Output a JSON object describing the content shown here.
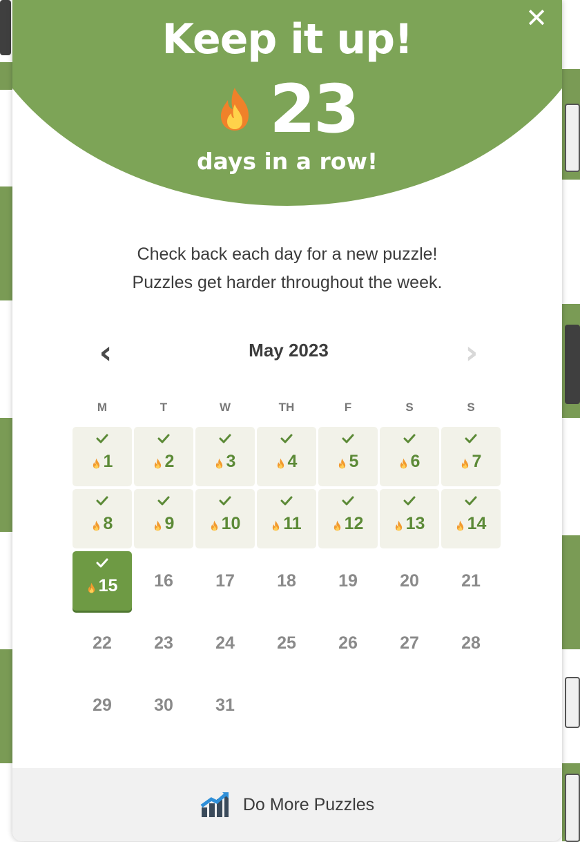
{
  "modal": {
    "title": "Keep it up!",
    "streak_count": "23",
    "streak_label": "days in a row!",
    "close_icon": "close-icon",
    "info_line1": "Check back each day for a new puzzle!",
    "info_line2": "Puzzles get harder throughout the week."
  },
  "calendar": {
    "month_label": "May 2023",
    "prev_icon": "chevron-left-icon",
    "next_icon": "chevron-right-icon",
    "weekdays": [
      "M",
      "T",
      "W",
      "TH",
      "F",
      "S",
      "S"
    ],
    "days": [
      {
        "day": "1",
        "status": "done"
      },
      {
        "day": "2",
        "status": "done"
      },
      {
        "day": "3",
        "status": "done"
      },
      {
        "day": "4",
        "status": "done"
      },
      {
        "day": "5",
        "status": "done"
      },
      {
        "day": "6",
        "status": "done"
      },
      {
        "day": "7",
        "status": "done"
      },
      {
        "day": "8",
        "status": "done"
      },
      {
        "day": "9",
        "status": "done"
      },
      {
        "day": "10",
        "status": "done"
      },
      {
        "day": "11",
        "status": "done"
      },
      {
        "day": "12",
        "status": "done"
      },
      {
        "day": "13",
        "status": "done"
      },
      {
        "day": "14",
        "status": "done"
      },
      {
        "day": "15",
        "status": "today"
      },
      {
        "day": "16",
        "status": "future"
      },
      {
        "day": "17",
        "status": "future"
      },
      {
        "day": "18",
        "status": "future"
      },
      {
        "day": "19",
        "status": "future"
      },
      {
        "day": "20",
        "status": "future"
      },
      {
        "day": "21",
        "status": "future"
      },
      {
        "day": "22",
        "status": "future"
      },
      {
        "day": "23",
        "status": "future"
      },
      {
        "day": "24",
        "status": "future"
      },
      {
        "day": "25",
        "status": "future"
      },
      {
        "day": "26",
        "status": "future"
      },
      {
        "day": "27",
        "status": "future"
      },
      {
        "day": "28",
        "status": "future"
      },
      {
        "day": "29",
        "status": "future"
      },
      {
        "day": "30",
        "status": "future"
      },
      {
        "day": "31",
        "status": "future"
      }
    ]
  },
  "footer": {
    "label": "Do More Puzzles",
    "icon": "puzzle-chart-icon"
  },
  "colors": {
    "header_green": "#7da457",
    "done_bg": "#f2f2e9",
    "done_text": "#5c8a37",
    "today_bg": "#6e9a44",
    "flame_orange": "#f29a2e"
  }
}
